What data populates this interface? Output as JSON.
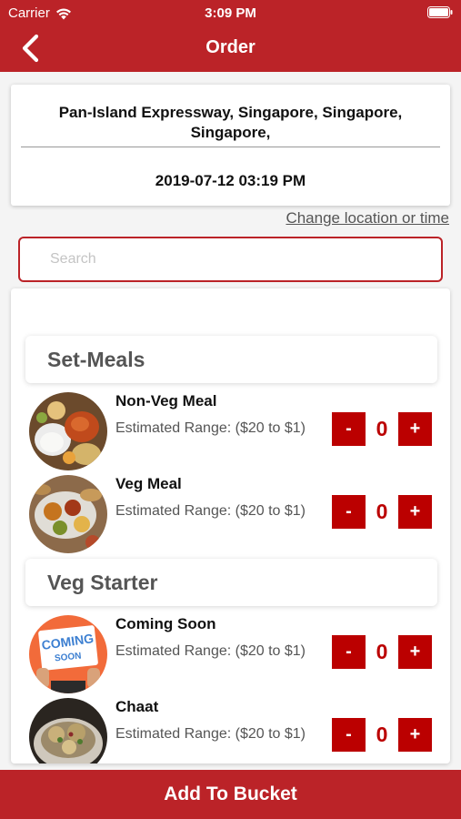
{
  "status_bar": {
    "carrier": "Carrier",
    "time": "3:09 PM"
  },
  "nav": {
    "title": "Order",
    "back_icon": "chevron-left-icon"
  },
  "location": {
    "address": "Pan-Island Expressway, Singapore, Singapore, Singapore,",
    "datetime": "2019-07-12 03:19 PM",
    "change_link": "Change location or time"
  },
  "search": {
    "placeholder": "Search",
    "value": ""
  },
  "sections": [
    {
      "title": "Set-Meals",
      "items": [
        {
          "name": "Non-Veg Meal",
          "range": "Estimated Range: ($20 to $1)",
          "qty": "0",
          "minus": "-",
          "plus": "+"
        },
        {
          "name": "Veg Meal",
          "range": "Estimated Range: ($20 to $1)",
          "qty": "0",
          "minus": "-",
          "plus": "+"
        }
      ]
    },
    {
      "title": "Veg Starter",
      "items": [
        {
          "name": "Coming Soon",
          "range": "Estimated Range: ($20 to $1)",
          "qty": "0",
          "minus": "-",
          "plus": "+",
          "thumb_text": "COMING SOON"
        },
        {
          "name": "Chaat",
          "range": "Estimated Range: ($20 to $1)",
          "qty": "0",
          "minus": "-",
          "plus": "+"
        }
      ]
    }
  ],
  "footer": {
    "button": "Add To Bucket"
  },
  "colors": {
    "primary": "#bb2328",
    "qty_button": "#bb0000",
    "placeholder_bg": "#f26b3a"
  }
}
